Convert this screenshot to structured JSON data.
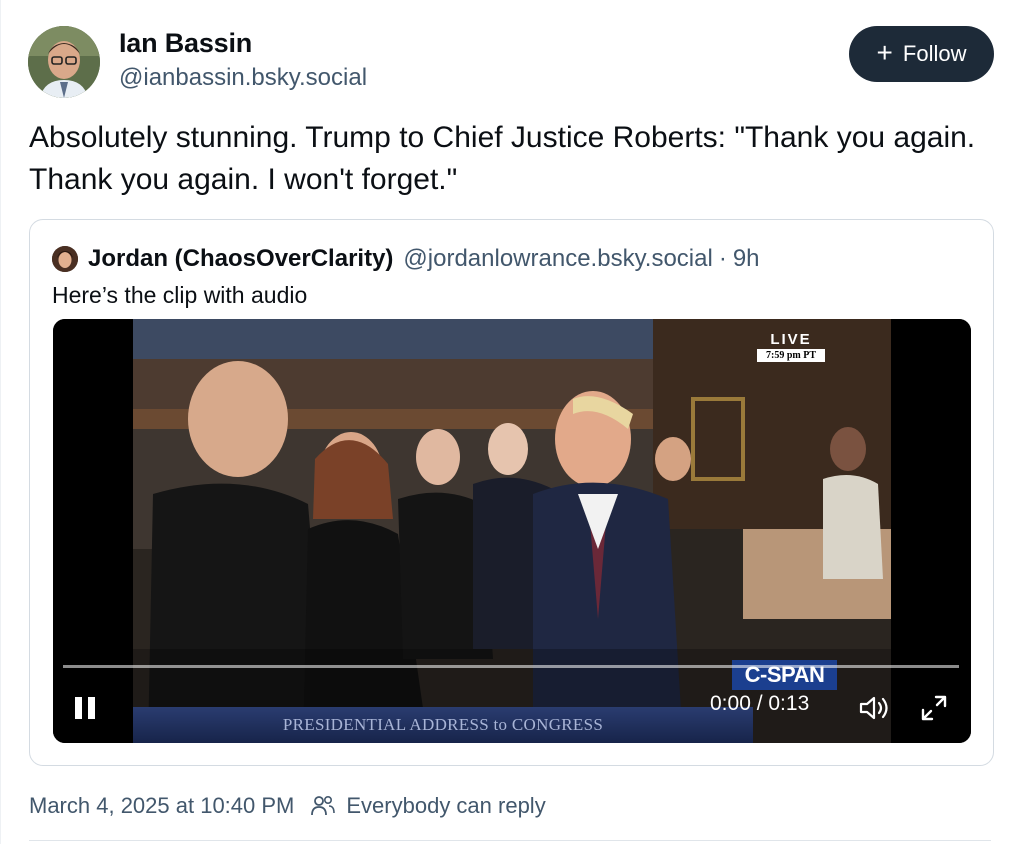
{
  "author": {
    "name": "Ian Bassin",
    "handle": "@ianbassin.bsky.social"
  },
  "follow_button": {
    "label": "Follow",
    "icon": "plus-icon"
  },
  "post_text": "Absolutely stunning.  Trump to Chief Justice Roberts: \"Thank you again. Thank you again. I won't forget.\"",
  "quote": {
    "author_name": "Jordan (ChaosOverClarity)",
    "handle": "@jordanlowrance.bsky.social",
    "separator": "·",
    "age": "9h",
    "text": "Here’s the clip with audio",
    "video": {
      "live_label": "LIVE",
      "live_time": "7:59 pm PT",
      "network_logo": "C-SPAN",
      "chyron": "PRESIDENTIAL ADDRESS to CONGRESS",
      "time_display": "0:00 / 0:13",
      "progress": 0.0,
      "controls": [
        "pause-icon",
        "volume-icon",
        "fullscreen-icon"
      ]
    }
  },
  "meta": {
    "timestamp": "March 4, 2025 at 10:40 PM",
    "reply_setting": "Everybody can reply",
    "reply_icon": "people-icon"
  },
  "colors": {
    "follow_bg": "#1d2a38",
    "muted_text": "#42576c",
    "card_border": "#d4dbe2"
  }
}
